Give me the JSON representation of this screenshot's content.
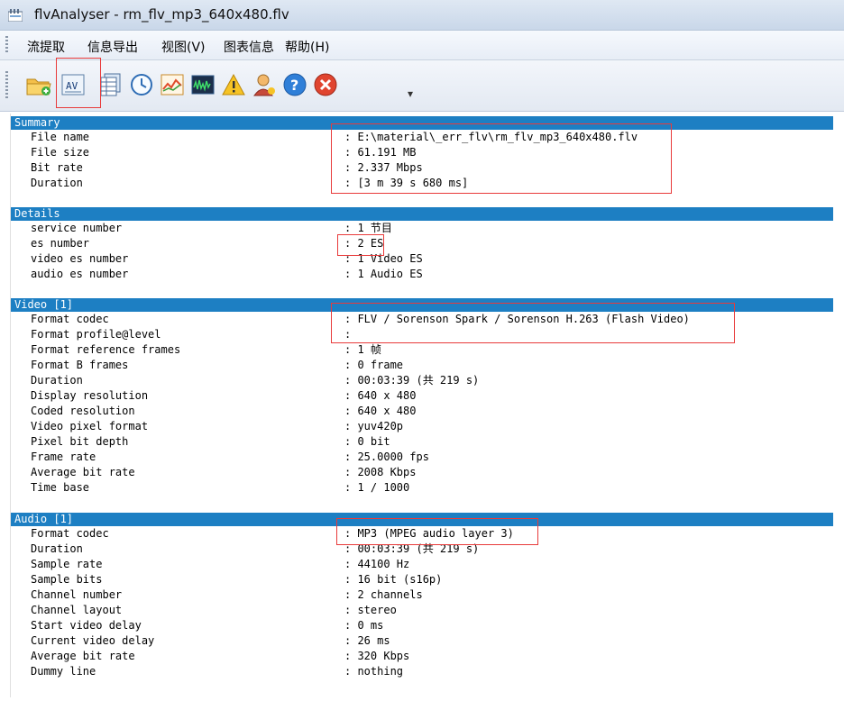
{
  "window": {
    "title": "flvAnalyser - rm_flv_mp3_640x480.flv"
  },
  "menu": {
    "items": [
      "流提取",
      "信息导出",
      "视图(V)",
      "图表信息",
      "帮助(H)"
    ]
  },
  "toolbar": {
    "buttons": [
      {
        "icon": "open-folder-icon"
      },
      {
        "icon": "av-icon",
        "label": "AV"
      },
      {
        "icon": "table-icon"
      },
      {
        "icon": "clock-icon"
      },
      {
        "icon": "chart-icon"
      },
      {
        "icon": "spectrum-icon"
      },
      {
        "icon": "warning-icon"
      },
      {
        "icon": "user-icon"
      },
      {
        "icon": "help-icon",
        "label": "?"
      },
      {
        "icon": "exit-icon"
      }
    ]
  },
  "summary": {
    "header": "Summary",
    "rows": [
      {
        "k": "File name",
        "v": ": E:\\material\\_err_flv\\rm_flv_mp3_640x480.flv"
      },
      {
        "k": "File size",
        "v": ": 61.191 MB"
      },
      {
        "k": "Bit rate",
        "v": ": 2.337 Mbps"
      },
      {
        "k": "Duration",
        "v": ": [3 m 39 s 680 ms]"
      }
    ]
  },
  "details": {
    "header": "Details",
    "rows": [
      {
        "k": "service number",
        "v": ": 1 节目"
      },
      {
        "k": "es number",
        "v": ": 2 ES"
      },
      {
        "k": "video es number",
        "v": ": 1 Video ES"
      },
      {
        "k": "audio es number",
        "v": ": 1 Audio ES"
      }
    ]
  },
  "video": {
    "header": "Video [1]",
    "rows": [
      {
        "k": "Format codec",
        "v": ": FLV / Sorenson Spark / Sorenson H.263 (Flash Video)"
      },
      {
        "k": "Format profile@level",
        "v": ":"
      },
      {
        "k": "Format reference frames",
        "v": ": 1 帧"
      },
      {
        "k": "Format B frames",
        "v": ": 0 frame"
      },
      {
        "k": "Duration",
        "v": ": 00:03:39 (共 219 s)"
      },
      {
        "k": "Display resolution",
        "v": ": 640 x 480"
      },
      {
        "k": "Coded resolution",
        "v": ": 640 x 480"
      },
      {
        "k": "Video pixel format",
        "v": ": yuv420p"
      },
      {
        "k": "Pixel bit depth",
        "v": ": 0 bit"
      },
      {
        "k": "Frame rate",
        "v": ": 25.0000 fps"
      },
      {
        "k": "Average bit rate",
        "v": ": 2008 Kbps"
      },
      {
        "k": "Time base",
        "v": ": 1 / 1000"
      }
    ]
  },
  "audio": {
    "header": "Audio [1]",
    "rows": [
      {
        "k": "Format codec",
        "v": ": MP3 (MPEG audio layer 3)"
      },
      {
        "k": "Duration",
        "v": ": 00:03:39 (共 219 s)"
      },
      {
        "k": "Sample rate",
        "v": ": 44100 Hz"
      },
      {
        "k": "Sample bits",
        "v": ": 16 bit (s16p)"
      },
      {
        "k": "Channel number",
        "v": ": 2 channels"
      },
      {
        "k": "Channel layout",
        "v": ": stereo"
      },
      {
        "k": "Start video delay",
        "v": ": 0 ms"
      },
      {
        "k": "Current video delay",
        "v": ": 26 ms"
      },
      {
        "k": "Average bit rate",
        "v": ": 320 Kbps"
      },
      {
        "k": "Dummy line",
        "v": ": nothing"
      }
    ]
  },
  "colors": {
    "section_header": "#1d7fc3",
    "highlight_box": "#e83a3a"
  }
}
